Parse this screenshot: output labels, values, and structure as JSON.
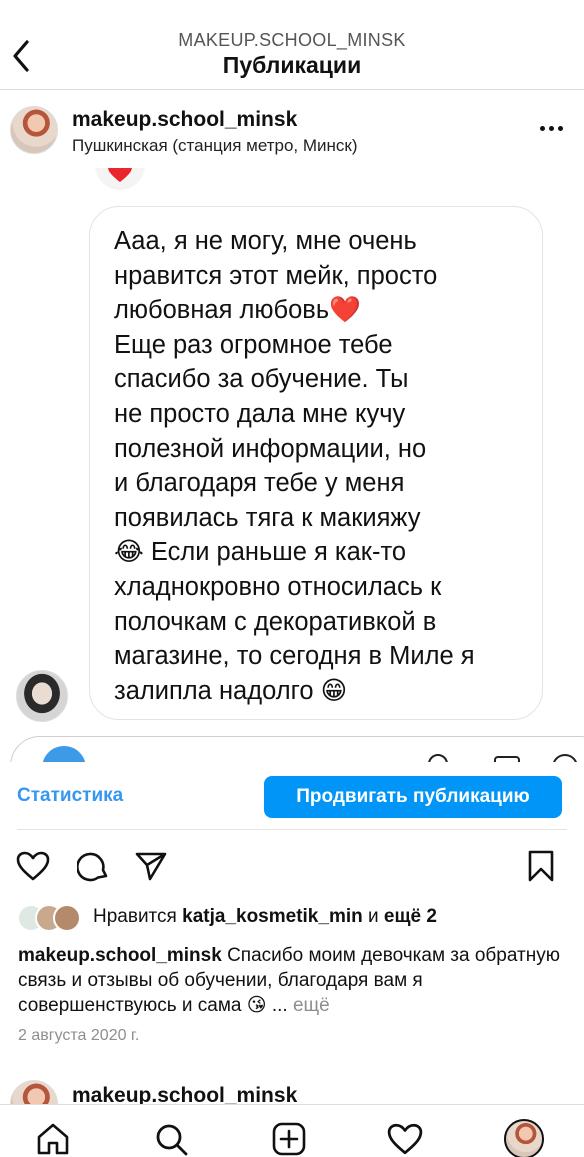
{
  "header": {
    "subtitle": "MAKEUP.SCHOOL_MINSK",
    "title": "Публикации"
  },
  "post": {
    "username": "makeup.school_minsk",
    "location": "Пушкинская (станция метро, Минск)",
    "comment_text": "Ааа,  я не могу,  мне очень\nнравится этот мейк, просто\nлюбовная любовь❤️\nЕще раз огромное тебе\nспасибо за обучение. Ты\nне просто дала мне кучу\nполезной информации,  но\nи благодаря тебе у меня\nпоявилась тяга к макияжу\n😂 Если раньше я как-то\nхладнокровно относилась к\nполочкам с декоративкой в\nмагазине,  то сегодня в Миле я\nзалипла надолго 😁"
  },
  "actions": {
    "statistics_label": "Статистика",
    "promote_label": "Продвигать публикацию"
  },
  "likes": {
    "prefix": "Нравится",
    "user": "katja_kosmetik_min",
    "and": "и",
    "more": "ещё 2"
  },
  "caption": {
    "username": "makeup.school_minsk",
    "text": "Спасибо моим девочкам за обратную связь и отзывы об обучении, благодаря вам я совершенствуюсь и сама 😘",
    "ellipsis": "...",
    "more_label": "ещё"
  },
  "date": "2 августа 2020 г.",
  "next_post": {
    "username": "makeup.school_minsk"
  },
  "icons": {
    "back": "chevron-left-icon",
    "more": "more-dots-icon",
    "like": "heart-icon",
    "comment": "comment-icon",
    "share": "paper-plane-icon",
    "save": "bookmark-icon",
    "home": "home-icon",
    "search": "search-icon",
    "add": "add-post-icon",
    "activity": "heart-icon",
    "profile": "profile-avatar"
  },
  "colors": {
    "accent": "#0095f6",
    "link": "#3797f0",
    "muted": "#8e8e8e"
  }
}
